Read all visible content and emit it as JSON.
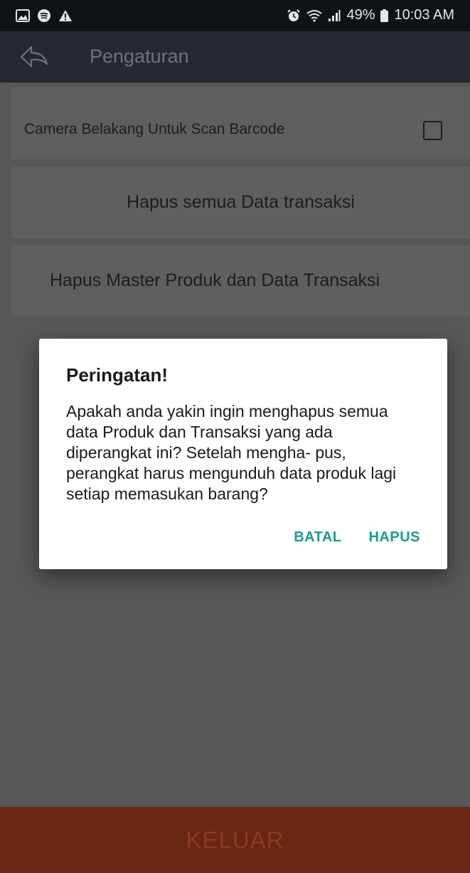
{
  "status_bar": {
    "icons_left": [
      "image-icon",
      "spotify-icon",
      "warning-icon"
    ],
    "icons_right": [
      "alarm-icon",
      "wifi-icon",
      "signal-icon"
    ],
    "battery": "49%",
    "time": "10:03 AM"
  },
  "app_bar": {
    "title": "Pengaturan"
  },
  "settings": {
    "camera_label": "Camera Belakang Untuk Scan Barcode",
    "camera_checked": false,
    "delete_transactions_label": "Hapus semua Data transaksi",
    "delete_master_label": "Hapus Master Produk dan Data Transaksi"
  },
  "dialog": {
    "title": "Peringatan!",
    "message": "Apakah anda yakin ingin menghapus semua data Produk dan Transaksi yang ada diperangkat ini? Setelah mengha- pus, perangkat harus mengunduh data produk lagi setiap memasukan barang?",
    "cancel_label": "BATAL",
    "confirm_label": "HAPUS"
  },
  "footer": {
    "exit_label": "KELUAR"
  },
  "colors": {
    "status_bar": "#101316",
    "app_bar": "#252a31",
    "overlay": "#575757",
    "accent": "#1b9a8a",
    "footer": "#6a2713"
  }
}
